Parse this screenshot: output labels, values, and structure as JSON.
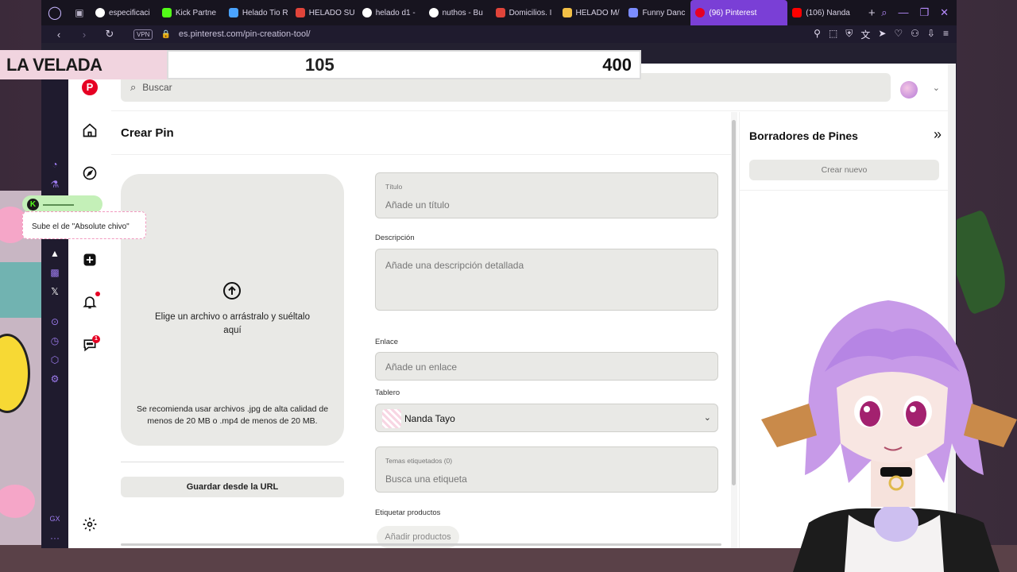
{
  "browser": {
    "tabs": [
      {
        "label": "especificaci",
        "color": "#ffffff"
      },
      {
        "label": "Kick Partne",
        "color": "#53fc18"
      },
      {
        "label": "Helado Tio R",
        "color": "#4aa3ff"
      },
      {
        "label": "HELADO SU",
        "color": "#e0443a"
      },
      {
        "label": "helado d1 -",
        "color": "#ffffff"
      },
      {
        "label": "nuthos - Bu",
        "color": "#ffffff"
      },
      {
        "label": "Domicilios. I",
        "color": "#e0443a"
      },
      {
        "label": "HELADO M/",
        "color": "#f3c046"
      },
      {
        "label": "Funny Danc",
        "color": "#7b8cff"
      },
      {
        "label": "(96) Pinterest",
        "color": "#e60023"
      },
      {
        "label": "(106) Nanda",
        "color": "#ff0000"
      }
    ],
    "vpn_label": "VPN",
    "url": "es.pinterest.com/pin-creation-tool/"
  },
  "overlay": {
    "title": "LA VELADA",
    "score_left": "105",
    "score_right": "400"
  },
  "chat": {
    "message": "Sube el de \"Absolute chivo\""
  },
  "search": {
    "placeholder": "Buscar"
  },
  "nav": {
    "notification_count": "1"
  },
  "create": {
    "title": "Crear Pin",
    "upload_text": "Elige un archivo o arrástralo y suéltalo aquí",
    "upload_note": "Se recomienda usar archivos .jpg de alta calidad de menos de 20 MB o .mp4 de menos de 20 MB.",
    "url_button": "Guardar desde la URL"
  },
  "form": {
    "title_label": "Título",
    "title_placeholder": "Añade un título",
    "description_label": "Descripción",
    "description_placeholder": "Añade una descripción detallada",
    "link_label": "Enlace",
    "link_placeholder": "Añade un enlace",
    "board_label": "Tablero",
    "board_value": "Nanda Tayo",
    "tags_label": "Temas etiquetados (0)",
    "tags_placeholder": "Busca una etiqueta",
    "products_label": "Etiquetar productos",
    "products_button": "Añadir productos"
  },
  "drafts": {
    "title": "Borradores de Pines",
    "new_button": "Crear nuevo"
  },
  "colors": {
    "pinterest_red": "#e60023",
    "opera_tab_active": "#7a3fd6"
  }
}
